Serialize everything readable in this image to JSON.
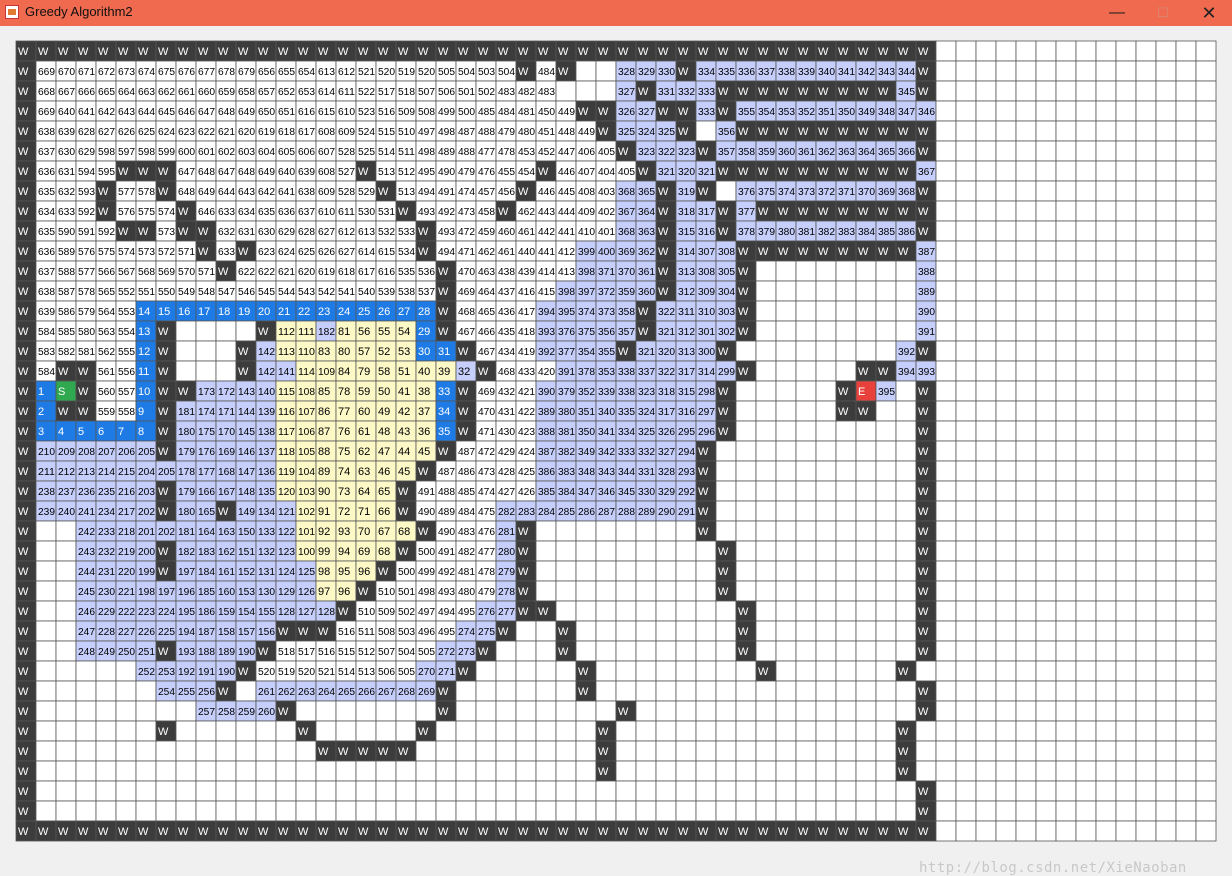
{
  "window": {
    "title": "Greedy Algorithm2",
    "min_glyph": "—",
    "max_glyph": "☐",
    "close_glyph": "✕"
  },
  "watermark": "http://blog.csdn.net/XieNaoban",
  "legend": {
    "wall": "W",
    "start": "S",
    "end": "E",
    "colors": {
      "wall": "#3c3c3c",
      "path": "#1e7be5",
      "start": "#2fa84f",
      "end": "#e8413c",
      "zone_blue": "#c6cffb",
      "zone_yellow": "#fdf9c7",
      "empty": "#ffffff",
      "gridline": "#555555"
    }
  },
  "grid": {
    "cols": 60,
    "rows": 40,
    "left_cols": 46,
    "rows_data": [
      "W,W,W,W,W,W,W,W,W,W,W,W,W,W,W,W,W,W,W,W,W,W,W,W,W,W,W,W,W,W,W,W,W,W,W,W,W,W,W,W,W,W,W,W,W,W",
      "W,669,670,671,672,673,674,675,676,677,678,679,656,655,654,613,612,521,520,519,520,505,504,503,504,W,484,W,,,328,329,330,W,334,335,336,337,338,339,340,341,342,343,344,W",
      "W,668,667,666,665,664,663,662,661,660,659,658,657,652,653,614,611,522,517,518,507,506,501,502,483,482,483,,,,327,W,331,332,333,W,W,W,W,W,W,W,W,W,345,W",
      "W,669,640,641,642,643,644,645,646,647,648,649,650,651,616,615,610,523,516,509,508,499,500,485,484,481,450,449,W,W,326,327,W,W,333,W,355,354,353,352,351,350,349,348,347,346,W",
      "W,638,639,628,627,626,625,624,623,622,621,620,619,618,617,608,609,524,515,510,497,498,487,488,479,480,451,448,449,W,325,324,325,W,,356,W,W,W,W,W,W,W,W,W,W,W",
      "W,637,630,629,598,597,598,599,600,601,602,603,604,605,606,607,528,525,514,511,498,489,488,477,478,453,452,447,406,405,W,323,322,323,W,357,358,359,360,361,362,363,364,365,366,W",
      "W,636,631,594,595,W,W,W,647,648,647,648,649,640,639,608,527,W,513,512,495,490,479,476,455,454,W,446,407,404,405,W,321,320,321,W,W,W,W,W,W,W,W,W,W,367,W",
      "W,635,632,593,W,577,578,W,648,649,644,643,642,641,638,609,528,529,W,513,494,491,474,457,456,W,446,445,408,403,368,365,W,319,W,,376,375,374,373,372,371,370,369,368,W",
      "W,634,633,592,W,576,575,574,W,646,633,634,635,636,637,610,611,530,531,W,493,492,473,458,W,462,443,444,409,402,367,364,W,318,317,W,377,W,W,W,W,W,W,W,W,W,W",
      "W,635,590,591,592,W,W,573,W,W,632,631,630,629,628,627,612,613,532,533,W,493,472,459,460,461,442,441,410,401,368,363,W,315,316,W,378,379,380,381,382,383,384,385,386,W",
      "W,636,589,576,575,574,573,572,571,W,633,W,623,624,625,626,627,614,615,534,W,494,471,462,461,440,441,412,399,400,369,362,W,314,307,308,W,W,W,W,W,W,W,W,W,387,W",
      "W,637,588,577,566,567,568,569,570,571,W,622,622,621,620,619,618,617,616,535,536,W,470,463,438,439,414,413,398,371,370,361,W,313,308,305,W,,,,,,,,,388,W",
      "W,638,587,578,565,552,551,550,549,548,547,546,545,544,543,542,541,540,539,538,537,W,469,464,437,416,415,398,397,372,359,360,W,312,309,304,W,,,,,,,,,389,W",
      "W,639,586,579,564,553,14,15,16,17,18,19,20,21,22,23,24,25,26,27,28,W,468,465,436,417,394,395,374,373,358,W,322,311,310,303,W,,,,,,,,,390,W",
      "W,584,585,580,563,554,13,W,,,,,W,112,111,182,81,56,55,54,29,W,467,466,435,418,393,376,375,356,357,W,321,312,301,302,W,,,,,,,,,391,W",
      "W,583,582,581,562,555,12,W,,,,W,142,113,110,83,80,57,52,53,30,31,W,467,434,419,392,377,354,355,W,321,320,313,300,W,,,,,,,,,392,W",
      "W,584,W,W,561,556,11,W,,,,W,142,141,114,109,84,79,58,51,40,39,32,W,468,433,420,391,378,353,338,337,322,317,314,299,W,,,,,,W,W,394,393,W",
      "W,1,S,W,560,557,10,W,W,173,172,143,140,115,108,85,78,59,50,41,38,33,W,469,432,421,390,379,352,339,338,323,318,315,298,W,,,,,,W,E,395,,W",
      "W,2,W,W,559,558,9,W,181,174,171,144,139,116,107,86,77,60,49,42,37,34,W,470,431,422,389,380,351,340,335,324,317,316,297,W,,,,,,W,W,,,W",
      "W,3,4,5,6,7,8,W,180,175,170,145,138,117,106,87,76,61,48,43,36,35,W,471,430,423,388,381,350,341,334,325,326,295,296,W,,,,,,,,,,W",
      "W,210,209,208,207,206,205,W,179,176,169,146,137,118,105,88,75,62,47,44,45,W,487,472,429,424,387,382,349,342,333,332,327,294,W,,,,,,,,,,,W",
      "W,211,212,213,214,215,204,205,178,177,168,147,136,119,104,89,74,63,46,45,W,487,486,473,428,425,386,383,348,343,344,331,328,293,W,,,,,,,,,,,W",
      "W,238,237,236,235,216,203,W,179,166,167,148,135,120,103,90,73,64,65,W,491,488,485,474,427,426,385,384,347,346,345,330,329,292,W,,,,,,,,,,,W",
      "W,239,240,241,234,217,202,W,180,165,W,149,134,121,102,91,72,71,66,W,490,489,484,475,282,283,284,285,286,287,288,289,290,291,W,,,,,,,,,,,W",
      "W,,,242,233,218,201,202,181,164,163,150,133,122,101,92,93,70,67,68,W,490,483,476,281,W,,,,,,,,,W,,,,,,,,,,,W",
      "W,,,243,232,219,200,W,182,183,162,151,132,123,100,99,94,69,68,W,500,491,482,477,280,W,,,,,,,,,,W,,,,,,,,,,W",
      "W,,,244,231,220,199,W,197,184,161,152,131,124,125,98,95,96,W,500,499,492,481,478,279,W,,,,,,,,,,W,,,,,,,,,,W",
      "W,,,245,230,221,198,197,196,185,160,153,130,129,126,97,96,W,510,501,498,493,480,479,278,W,,,,,,,,,,W,,,,,,,,,,W",
      "W,,,246,229,222,223,224,195,186,159,154,155,128,127,128,W,510,509,502,497,494,495,276,277,W,W,,,,,,,,,,W,,,,,,,,,W",
      "W,,,247,228,227,226,225,194,187,158,157,156,W,W,W,516,511,508,503,496,495,274,275,W,,,W,,,,,,,,,W,,,,,,,,,W",
      "W,,,248,249,250,251,W,193,188,189,190,W,518,517,516,515,512,507,504,505,272,273,W,,,,W,,,,,,,,,W,,,,,,,,,W",
      "W,,,,,,252,253,192,191,190,W,520,519,520,521,514,513,506,505,270,271,W,,,,,,W,,,,,,,,,W,,,,,,,W",
      "W,,,,,,,254,255,256,W,,261,262,263,264,265,266,267,268,269,W,,,,,,,W,,,,,,,,,,,,,,,,,W",
      "W,,,,,,,,,257,258,259,260,W,,,,,,,,W,,,,,,,,,W,,,,,,,,,,,,,,,W",
      "W,,,,,,,W,,,,,,,W,,,,,,W,,,,,,,,,W,,,,,,,,,,,,,,,W",
      "W,,,,,,,,,,,,,,,W,W,W,W,W,,,,,,,,,,W,,,,,,,,,,,,,,,W",
      "W,,,,,,,,,,,,,,,,,,,,,,,,,,,,,W,,,,,,,,,,,,,,,W",
      "W,,,,,,,,,,,,,,,,,,,,,,,,,,,,,,,,,,,,,,,,,,,,,W",
      "W,,,,,,,,,,,,,,,,,,,,,,,,,,,,,,,,,,,,,,,,,,,,,W",
      "W,W,W,W,W,W,W,W,W,W,W,W,W,W,W,W,W,W,W,W,W,W,W,W,W,W,W,W,W,W,W,W,W,W,W,W,W,W,W,W,W,W,W,W,W,W"
    ]
  }
}
